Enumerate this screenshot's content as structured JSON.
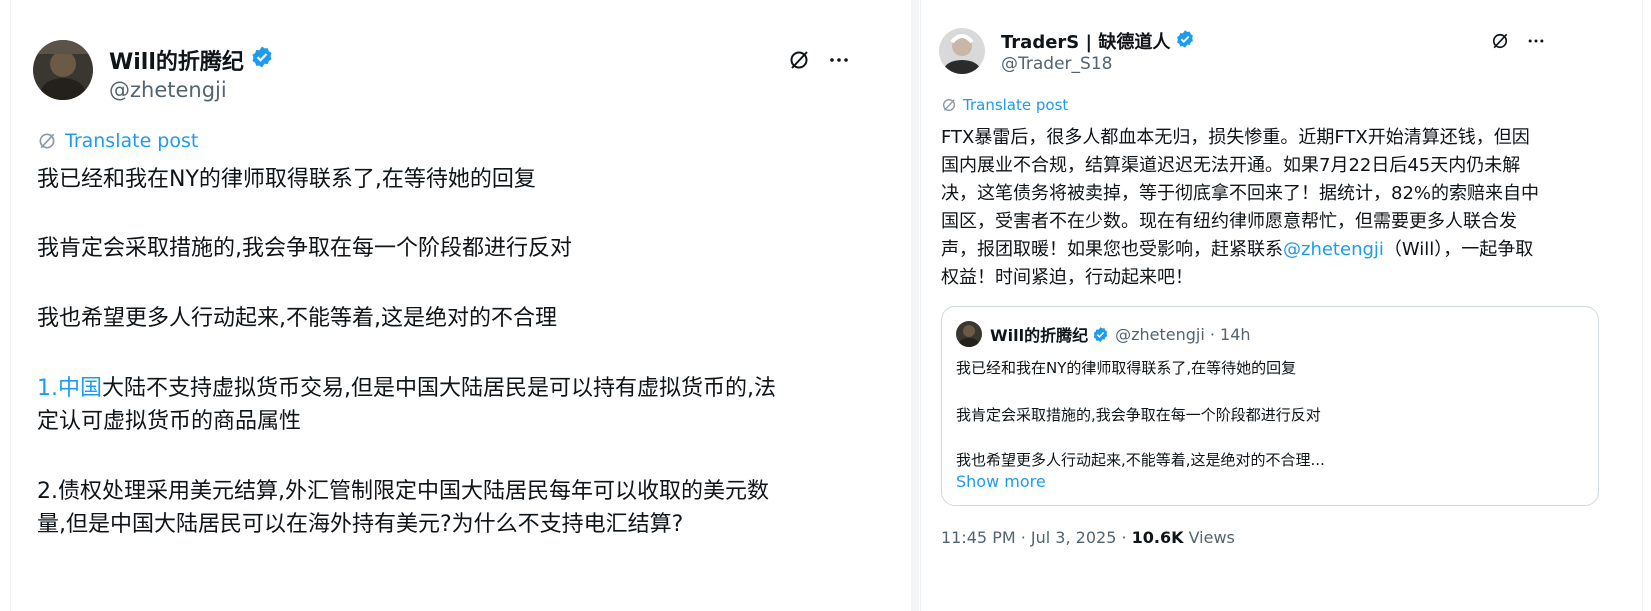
{
  "left_tweet": {
    "author_name": "Will的折腾纪",
    "author_handle": "@zhetengji",
    "translate_label": "Translate post",
    "paragraphs": [
      {
        "text": "我已经和我在NY的律师取得联系了,在等待她的回复"
      },
      {
        "text": "我肯定会采取措施的,我会争取在每一个阶段都进行反对"
      },
      {
        "text": "我也希望更多人行动起来,不能等着,这是绝对的不合理"
      },
      {
        "link": "1.中国",
        "line1_rest": "大陆不支持虚拟货币交易,但是中国大陆居民是可以持有虚拟货币的,法",
        "line2": "定认可虚拟货币的商品属性"
      },
      {
        "line1": "2.债权处理采用美元结算,外汇管制限定中国大陆居民每年可以收取的美元数",
        "line2": "量,但是中国大陆居民可以在海外持有美元?为什么不支持电汇结算?"
      }
    ]
  },
  "right_tweet": {
    "author_name": "TraderS | 缺德道人",
    "author_handle": "@Trader_S18",
    "translate_label": "Translate post",
    "body_lines": [
      "FTX暴雷后，很多人都血本无归，损失惨重。近期FTX开始清算还钱，但因",
      "国内展业不合规，结算渠道迟迟无法开通。如果7月22日后45天内仍未解",
      "决，这笔债务将被卖掉，等于彻底拿不回来了！据统计，82%的索赔来自中",
      "国区，受害者不在少数。现在有纽约律师愿意帮忙，但需要更多人联合发",
      "权益！时间紧迫，行动起来吧！"
    ],
    "body_line5_pre": "声，报团取暖！如果您也受影响，赶紧联系",
    "body_line5_link": "@zhetengji",
    "body_line5_post": "（Will），一起争取",
    "quote": {
      "name": "Will的折腾纪",
      "meta": "@zhetengji · 14h",
      "lines": [
        "我已经和我在NY的律师取得联系了,在等待她的回复",
        "我肯定会采取措施的,我会争取在每一个阶段都进行反对",
        "我也希望更多人行动起来,不能等着,这是绝对的不合理..."
      ],
      "show_more": "Show more"
    },
    "footer": {
      "time": "11:45 PM · Jul 3, 2025 · ",
      "views_count": "10.6K",
      "views_label": " Views"
    }
  },
  "colors": {
    "link": "#1d9bf0",
    "verified": "#1d9bf0",
    "muted": "#536471"
  },
  "icons": [
    "grok-icon",
    "more-icon",
    "verified-badge-icon",
    "translate-icon"
  ]
}
